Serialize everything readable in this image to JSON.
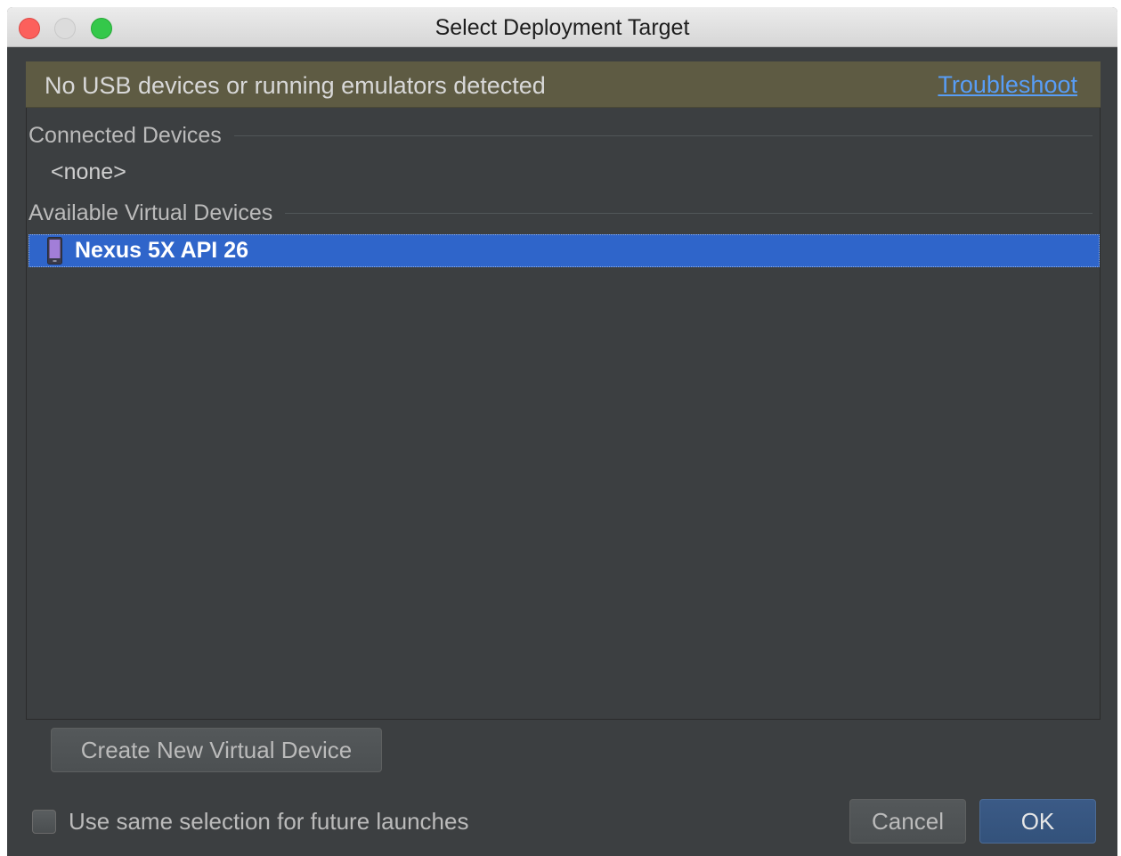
{
  "window": {
    "title": "Select Deployment Target"
  },
  "banner": {
    "message": "No USB devices or running emulators detected",
    "link_label": "Troubleshoot"
  },
  "connected_devices": {
    "header": "Connected Devices",
    "items": [
      "<none>"
    ]
  },
  "virtual_devices": {
    "header": "Available Virtual Devices",
    "items": [
      {
        "label": "Nexus 5X API 26",
        "icon": "phone-icon",
        "selected": true
      }
    ]
  },
  "buttons": {
    "create_label": "Create New Virtual Device",
    "cancel_label": "Cancel",
    "ok_label": "OK"
  },
  "checkbox": {
    "label": "Use same selection for future launches",
    "checked": false
  },
  "colors": {
    "background": "#3c3f41",
    "banner": "#5e5b43",
    "selection": "#2f65ca",
    "link": "#589df6"
  }
}
